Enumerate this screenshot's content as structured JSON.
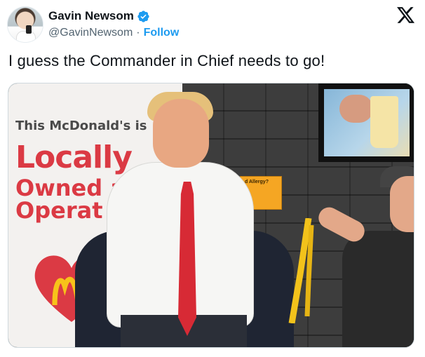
{
  "user": {
    "display_name": "Gavin Newsom",
    "handle": "@GavinNewsom",
    "separator": "·",
    "follow_label": "Follow",
    "verified_icon": "verified-badge-icon",
    "verified_color": "#1d9bf0"
  },
  "brand_icon": "x-logo-icon",
  "tweet": {
    "text": "I guess the Commander in Chief needs to go!"
  },
  "media": {
    "sign": {
      "line1": "This McDonald's is",
      "line2": "Locally",
      "line3": "Owned a",
      "line4": "Operat"
    },
    "allergy_label": "d Allergy?",
    "accent_red": "#db3a44"
  }
}
